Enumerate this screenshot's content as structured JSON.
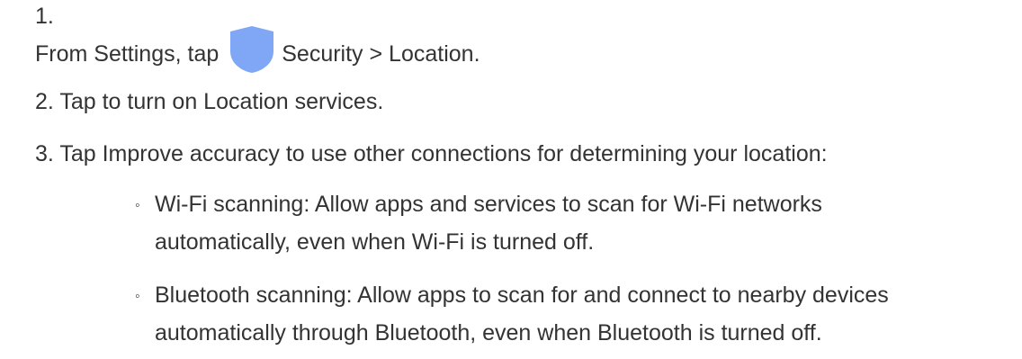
{
  "steps": [
    {
      "number": "1.",
      "text_before_icon": "From Settings, tap",
      "icon": "shield-icon",
      "text_after_icon": "Security > Location."
    },
    {
      "text": "2. Tap to turn on Location services."
    },
    {
      "text": "3. Tap Improve accuracy to use other connections for determining your location:"
    }
  ],
  "sub_items": [
    {
      "bullet": "◦",
      "line1": "Wi-Fi scanning: Allow apps and services to scan for Wi-Fi networks",
      "line2": "automatically, even when Wi-Fi is turned off."
    },
    {
      "bullet": "◦",
      "line1": "Bluetooth scanning: Allow apps to scan for and connect to nearby devices",
      "line2": "automatically through Bluetooth, even when Bluetooth is turned off."
    }
  ],
  "colors": {
    "text": "#333333",
    "shield": "#7fa7f5"
  }
}
